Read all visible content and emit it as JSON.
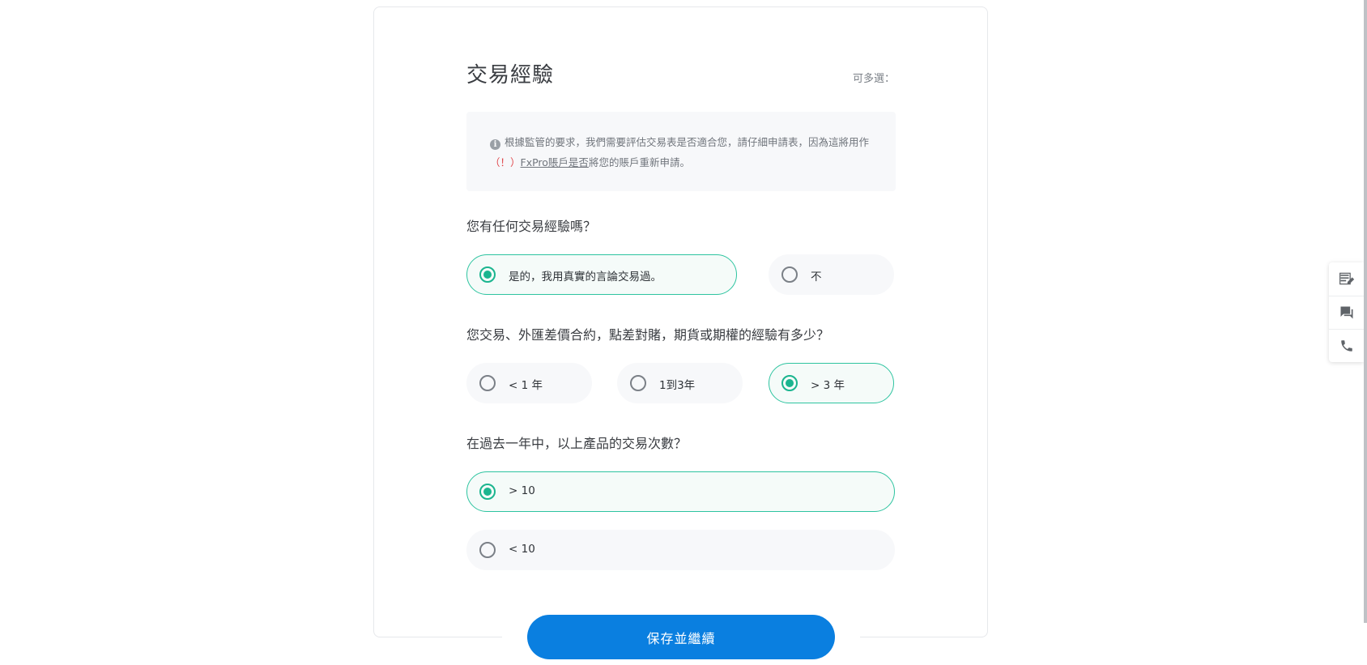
{
  "form": {
    "title": "交易經驗",
    "multi_select_hint": "可多選：",
    "info": {
      "text_before": "根據監管的要求，我們需要評估交易表是否適合您，請仔細申請表，因為這將用作",
      "warning": "（！）",
      "link": "FxPro賬戶是否",
      "text_after": "將您的賬戶重新申請。"
    },
    "questions": [
      {
        "label": "您有任何交易經驗嗎？",
        "options": [
          {
            "label": "是的，我用真實的言論交易過。",
            "selected": true
          },
          {
            "label": "不",
            "selected": false
          }
        ]
      },
      {
        "label": "您交易、外匯差價合約，點差對賭，期貨或期權的經驗有多少？",
        "options": [
          {
            "label": "< 1 年",
            "selected": false
          },
          {
            "label": "1到3年",
            "selected": false
          },
          {
            "label": "> 3 年",
            "selected": true
          }
        ]
      },
      {
        "label": "在過去一年中，以上產品的交易次數？",
        "options": [
          {
            "label": "> 10",
            "selected": true
          },
          {
            "label": "< 10",
            "selected": false
          }
        ]
      }
    ],
    "save_label": "保存並繼續"
  },
  "sidebar": {
    "items": [
      {
        "icon": "edit-form-icon"
      },
      {
        "icon": "chat-icon"
      },
      {
        "icon": "phone-icon"
      }
    ]
  },
  "colors": {
    "accent_green": "#1bb58f",
    "primary_button": "#0a7fe0",
    "warning_red": "#e0464a"
  }
}
